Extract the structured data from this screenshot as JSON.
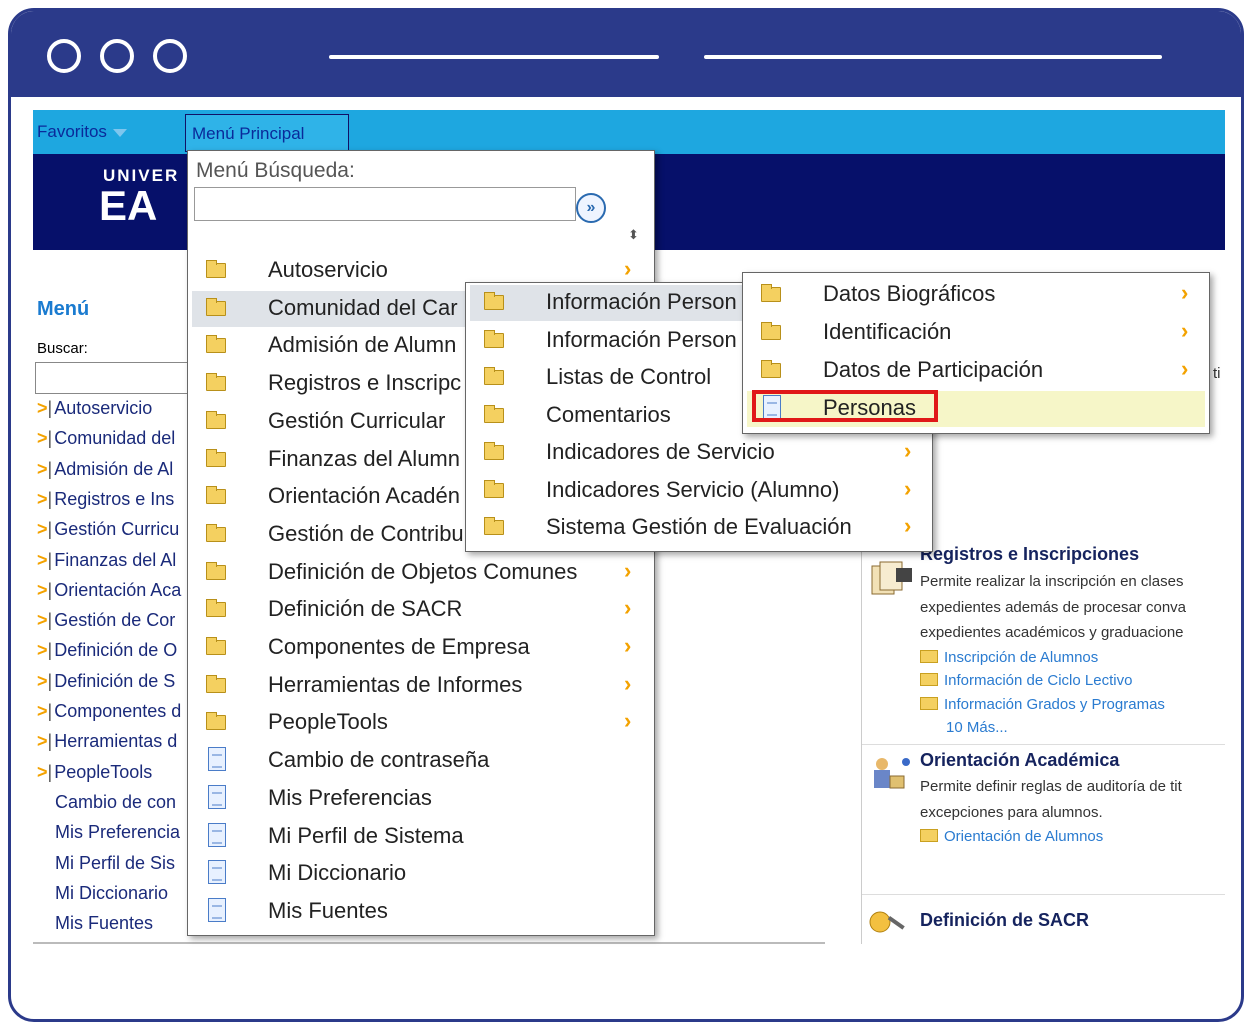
{
  "topbar": {
    "favoritos": "Favoritos",
    "menu_principal": "Menú Principal"
  },
  "banner": {
    "logo_top": "UNIVER",
    "logo_bottom": "EA"
  },
  "left_nav": {
    "title": "Menú",
    "search_label": "Buscar:",
    "items": [
      {
        "label": "Autoservicio",
        "folder": true
      },
      {
        "label": "Comunidad del",
        "folder": true
      },
      {
        "label": "Admisión de Al",
        "folder": true
      },
      {
        "label": "Registros e Ins",
        "folder": true
      },
      {
        "label": "Gestión Curricu",
        "folder": true
      },
      {
        "label": "Finanzas del Al",
        "folder": true
      },
      {
        "label": "Orientación Aca",
        "folder": true
      },
      {
        "label": "Gestión de Cor",
        "folder": true
      },
      {
        "label": "Definición de O",
        "folder": true
      },
      {
        "label": "Definición de S",
        "folder": true
      },
      {
        "label": "Componentes d",
        "folder": true
      },
      {
        "label": "Herramientas d",
        "folder": true
      },
      {
        "label": "PeopleTools",
        "folder": true
      },
      {
        "label": "Cambio de con",
        "folder": false
      },
      {
        "label": "Mis Preferencia",
        "folder": false
      },
      {
        "label": "Mi Perfil de Sis",
        "folder": false
      },
      {
        "label": "Mi Diccionario",
        "folder": false
      },
      {
        "label": "Mis Fuentes",
        "folder": false
      }
    ]
  },
  "menu_principal": {
    "search_label": "Menú Búsqueda:",
    "search_value": "",
    "items": [
      {
        "label": "Autoservicio",
        "type": "folder"
      },
      {
        "label": "Comunidad del Car",
        "type": "folder"
      },
      {
        "label": "Admisión de Alumn",
        "type": "folder"
      },
      {
        "label": "Registros e Inscripc",
        "type": "folder"
      },
      {
        "label": "Gestión Curricular",
        "type": "folder"
      },
      {
        "label": "Finanzas del Alumn",
        "type": "folder"
      },
      {
        "label": "Orientación Acadén",
        "type": "folder"
      },
      {
        "label": "Gestión de Contribu",
        "type": "folder"
      },
      {
        "label": "Definición de Objetos Comunes",
        "type": "folder"
      },
      {
        "label": "Definición de SACR",
        "type": "folder"
      },
      {
        "label": "Componentes de Empresa",
        "type": "folder"
      },
      {
        "label": "Herramientas de Informes",
        "type": "folder"
      },
      {
        "label": "PeopleTools",
        "type": "folder"
      },
      {
        "label": "Cambio de contraseña",
        "type": "page"
      },
      {
        "label": "Mis Preferencias",
        "type": "page"
      },
      {
        "label": "Mi Perfil de Sistema",
        "type": "page"
      },
      {
        "label": "Mi Diccionario",
        "type": "page"
      },
      {
        "label": "Mis Fuentes",
        "type": "page"
      }
    ]
  },
  "submenu_comunidad": {
    "items": [
      {
        "label": "Información Person"
      },
      {
        "label": "Información Person"
      },
      {
        "label": "Listas de Control"
      },
      {
        "label": "Comentarios"
      },
      {
        "label": "Indicadores de Servicio"
      },
      {
        "label": "Indicadores Servicio (Alumno)"
      },
      {
        "label": "Sistema Gestión de Evaluación"
      }
    ]
  },
  "submenu_informacion": {
    "items": [
      {
        "label": "Datos Biográficos",
        "type": "folder"
      },
      {
        "label": "Identificación",
        "type": "folder"
      },
      {
        "label": "Datos de Participación",
        "type": "folder"
      },
      {
        "label": "Personas",
        "type": "page"
      }
    ]
  },
  "right_panel": {
    "registros": {
      "title": "Registros e Inscripciones",
      "lines": [
        "Permite realizar la inscripción en clases",
        "expedientes además de procesar conva",
        "expedientes académicos y graduacione"
      ],
      "links": [
        "Inscripción de Alumnos",
        "Información de Ciclo Lectivo",
        "Información Grados y Programas"
      ],
      "more": "10 Más..."
    },
    "orientacion": {
      "title": "Orientación Académica",
      "lines": [
        "Permite definir reglas de auditoría de tit",
        "excepciones para alumnos."
      ],
      "links": [
        "Orientación de Alumnos"
      ]
    },
    "sacr": {
      "title": "Definición de SACR"
    },
    "edge_text": "ti"
  },
  "colors": {
    "frame": "#2b3a8a",
    "topbar": "#1ea7e0",
    "banner": "#06106a",
    "highlight_box": "#e01818"
  }
}
